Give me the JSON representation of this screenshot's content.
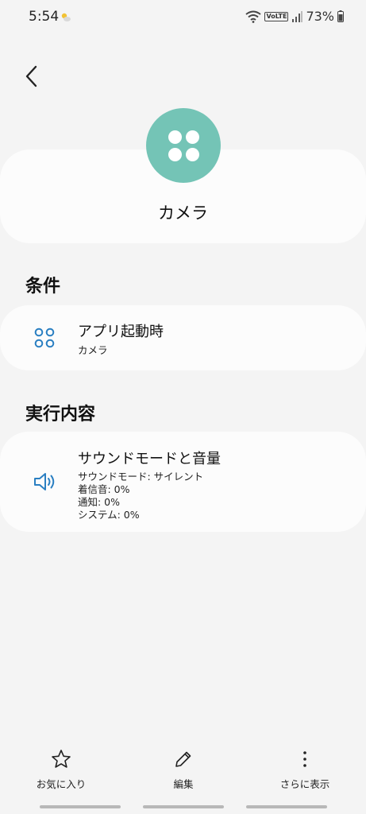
{
  "status_bar": {
    "time": "5:54",
    "battery": "73%",
    "network_label": "VoLTE"
  },
  "app": {
    "name": "カメラ",
    "icon_color": "#74c4b6"
  },
  "conditions": {
    "section_title": "条件",
    "item": {
      "title": "アプリ起動時",
      "subtitle": "カメラ"
    }
  },
  "actions": {
    "section_title": "実行内容",
    "item": {
      "title": "サウンドモードと音量",
      "lines": [
        "サウンドモード: サイレント",
        "着信音: 0%",
        "通知: 0%",
        "システム: 0%"
      ]
    }
  },
  "bottom_bar": {
    "favorite_label": "お気に入り",
    "edit_label": "編集",
    "more_label": "さらに表示"
  },
  "accent_color": "#2a7fc2"
}
